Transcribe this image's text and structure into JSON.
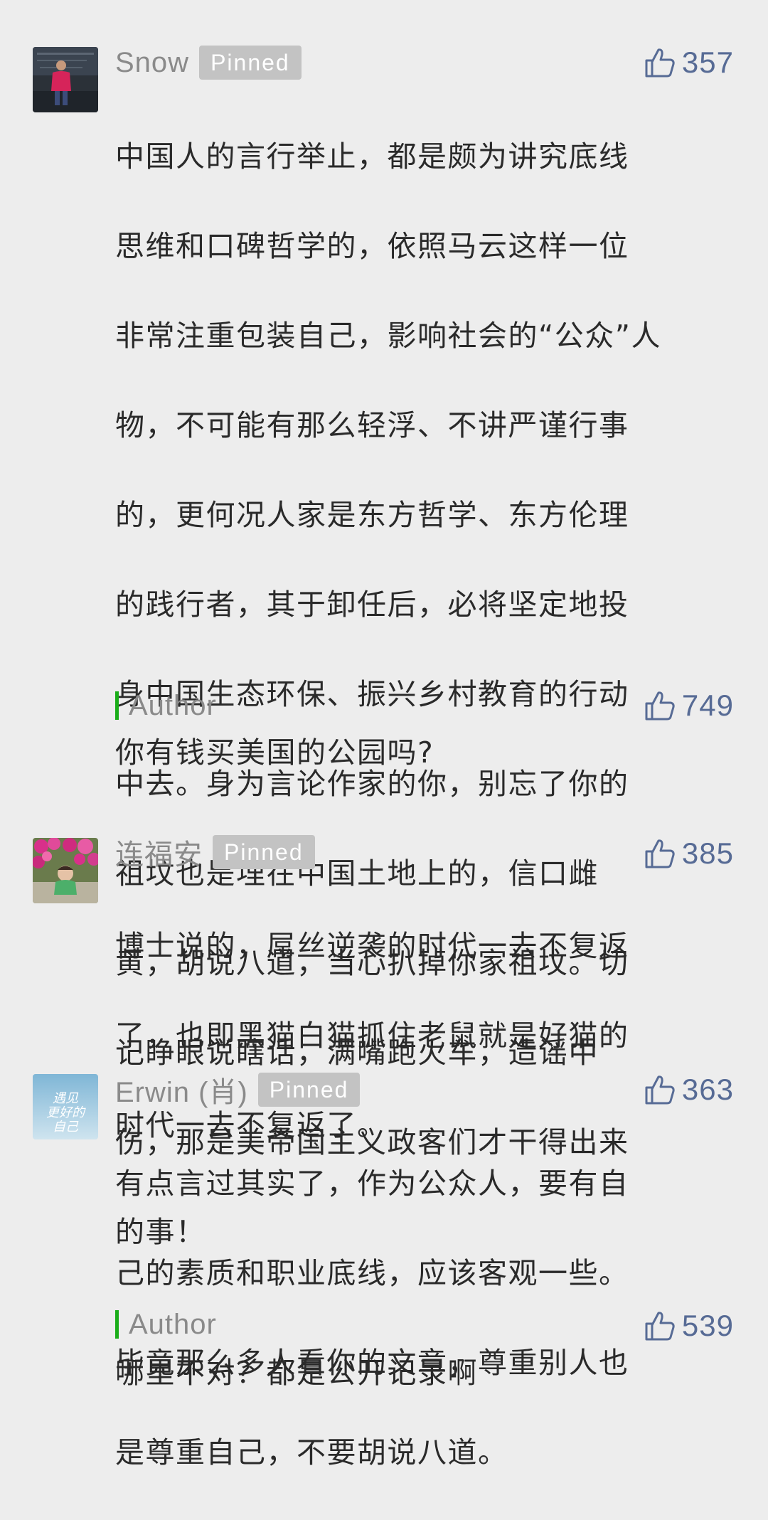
{
  "comments": [
    {
      "author": "Snow",
      "pinned_label": "Pinned",
      "likes": "357",
      "lines": [
        "中国人的言行举止，都是颇为讲究底线",
        "思维和口碑哲学的，依照马云这样一位",
        "非常注重包装自己，影响社会的“公众”人",
        "物，不可能有那么轻浮、不讲严谨行事",
        "的，更何况人家是东方哲学、东方伦理",
        "的践行者，其于卸任后，必将坚定地投",
        "身中国生态环保、振兴乡村教育的行动",
        "中去。身为言论作家的你，别忘了你的",
        "祖坟也是埋在中国土地上的，信口雌",
        "黄，胡说八道，当心扒掉你家祖坟。切",
        "记睁眼说瞎话，满嘴跑火车，造谣中",
        "伤，那是美帝国主义政客们才干得出来",
        "的事！"
      ],
      "reply": {
        "author": "Author",
        "likes": "749",
        "text": "你有钱买美国的公园吗?"
      }
    },
    {
      "author": "连福安",
      "pinned_label": "Pinned",
      "likes": "385",
      "lines": [
        "博士说的，屌丝逆袭的时代一去不复返",
        "了，也即黑猫白猫抓住老鼠就是好猫的",
        "时代一去不复返了。"
      ]
    },
    {
      "author": "Erwin (肖)",
      "pinned_label": "Pinned",
      "likes": "363",
      "lines": [
        "有点言过其实了，作为公众人，要有自",
        "己的素质和职业底线，应该客观一些。",
        "毕竟那么多人看你的文章，尊重别人也",
        "是尊重自己，不要胡说八道。"
      ],
      "reply": {
        "author": "Author",
        "likes": "539",
        "text": "哪里不对？都是公开记录啊"
      }
    }
  ],
  "colors": {
    "background": "#ededed",
    "name": "#8a8a8a",
    "pinned_badge": "#c3c3c3",
    "like_count": "#576b95",
    "reply_bar": "#1aad19",
    "body_text": "#2a2a2a"
  },
  "icons": {
    "like": "thumbs-up-icon",
    "avatar_1": "person-photo-avatar",
    "avatar_2": "flowers-child-photo-avatar",
    "avatar_3": "calligraphy-avatar"
  },
  "avatar_3_text": "遇见更好的自己"
}
